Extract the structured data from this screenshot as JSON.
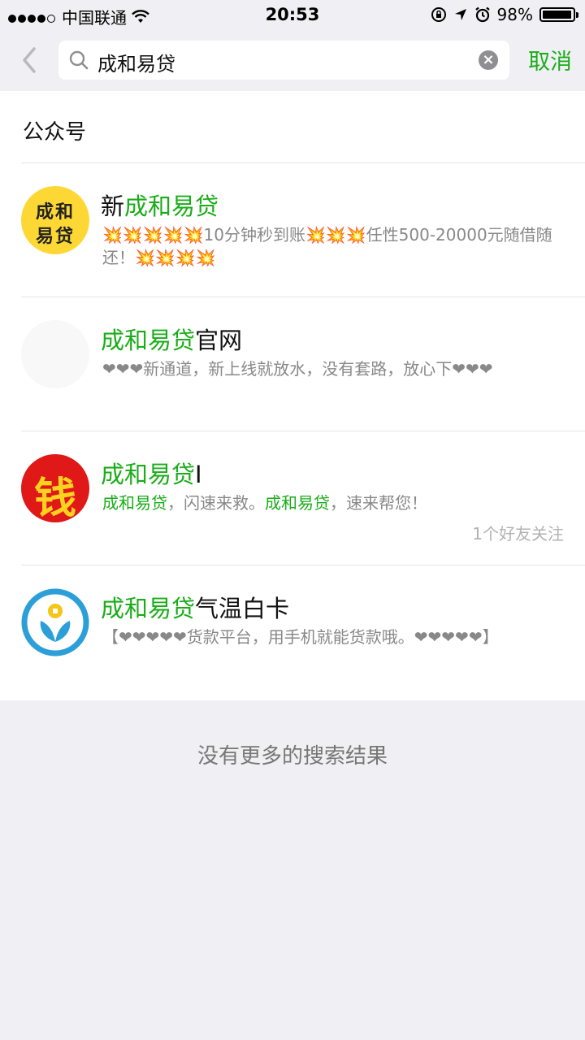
{
  "status_bar": {
    "carrier": "中国联通",
    "time": "20:53",
    "battery": "98%",
    "battery_level": 0.98
  },
  "search": {
    "query": "成和易贷",
    "cancel_label": "取消"
  },
  "section": {
    "title": "公众号"
  },
  "results": [
    {
      "name_prefix": "新",
      "name_highlight": "成和易贷",
      "name_suffix": "",
      "avatar_text_line1": "成和",
      "avatar_text_line2": "易贷",
      "desc_part1": "💥💥💥💥💥10分钟秒到账💥💥💥任性500-20000元随借随还！💥💥💥💥"
    },
    {
      "name_prefix": "",
      "name_highlight": "成和易贷",
      "name_suffix": "官网",
      "desc_part1": "❤❤❤新通道，新上线就放水，没有套路，放心下❤❤❤"
    },
    {
      "name_prefix": "",
      "name_highlight": "成和易贷",
      "name_suffix": "I",
      "avatar_text": "钱",
      "desc_hl1": "成和易贷",
      "desc_mid": "，闪速来救。",
      "desc_hl2": "成和易贷",
      "desc_end": "，速来帮您！",
      "followers": "1个好友关注"
    },
    {
      "name_prefix": "",
      "name_highlight": "成和易贷",
      "name_suffix": "气温白卡",
      "desc_part1": "【❤❤❤❤❤货款平台，用手机就能货款哦。❤❤❤❤❤】"
    }
  ],
  "footer": {
    "no_more": "没有更多的搜索结果"
  },
  "colors": {
    "accent": "#1aad19",
    "avatar_yellow": "#fdd835",
    "avatar_red": "#e01818",
    "avatar_blue": "#2d9fd8"
  },
  "icons": [
    "wifi-icon",
    "orientation-lock-icon",
    "location-arrow-icon",
    "alarm-icon",
    "back-chevron-icon",
    "search-icon",
    "clear-icon"
  ]
}
